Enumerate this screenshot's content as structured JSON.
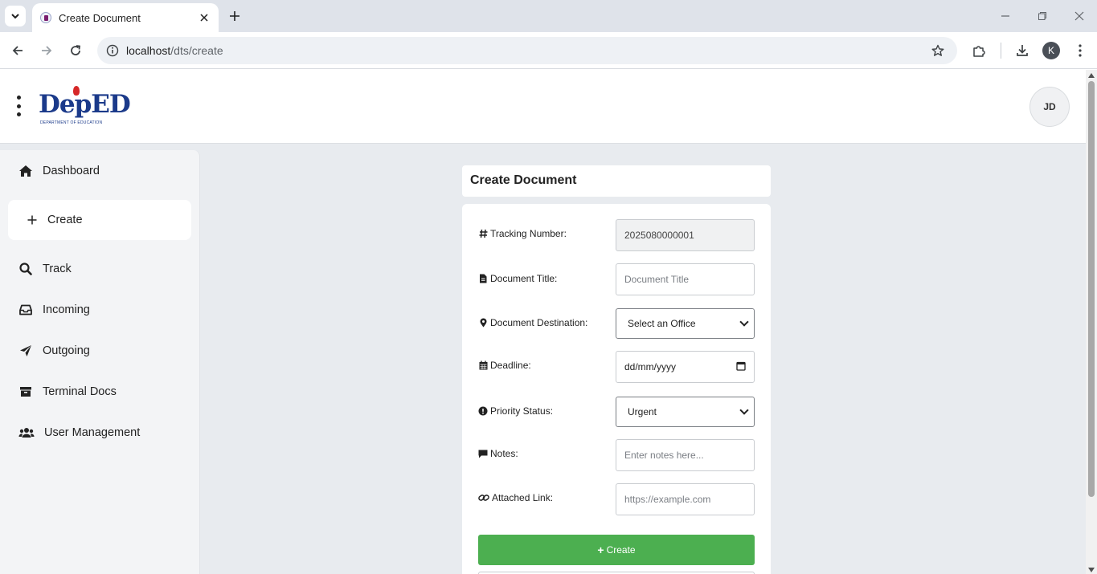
{
  "browser": {
    "tab_title": "Create Document",
    "url_host": "localhost",
    "url_path": "/dts/create",
    "profile_initial": "K"
  },
  "header": {
    "logo_text": "DepED",
    "logo_subtext": "DEPARTMENT OF EDUCATION",
    "avatar_initials": "JD"
  },
  "sidebar": {
    "items": [
      {
        "label": "Dashboard",
        "icon": "home-icon"
      },
      {
        "label": "Create",
        "icon": "plus-icon",
        "active": true
      },
      {
        "label": "Track",
        "icon": "search-icon"
      },
      {
        "label": "Incoming",
        "icon": "inbox-icon"
      },
      {
        "label": "Outgoing",
        "icon": "paper-plane-icon"
      },
      {
        "label": "Terminal Docs",
        "icon": "archive-icon"
      },
      {
        "label": "User Management",
        "icon": "users-icon"
      }
    ]
  },
  "form": {
    "title": "Create Document",
    "fields": {
      "tracking": {
        "label": "Tracking Number:",
        "value": "2025080000001"
      },
      "title": {
        "label": "Document Title:",
        "placeholder": "Document Title"
      },
      "destination": {
        "label": "Document Destination:",
        "selected": "Select an Office"
      },
      "deadline": {
        "label": "Deadline:",
        "value": "dd/mm/yyyy"
      },
      "priority": {
        "label": "Priority Status:",
        "selected": "Urgent"
      },
      "notes": {
        "label": "Notes:",
        "placeholder": "Enter notes here..."
      },
      "link": {
        "label": "Attached Link:",
        "placeholder": "https://example.com"
      }
    },
    "submit_label": "Create"
  },
  "colors": {
    "submit": "#4caf50",
    "page_bg": "#e8ebef",
    "sidebar_bg": "#f3f4f6"
  }
}
